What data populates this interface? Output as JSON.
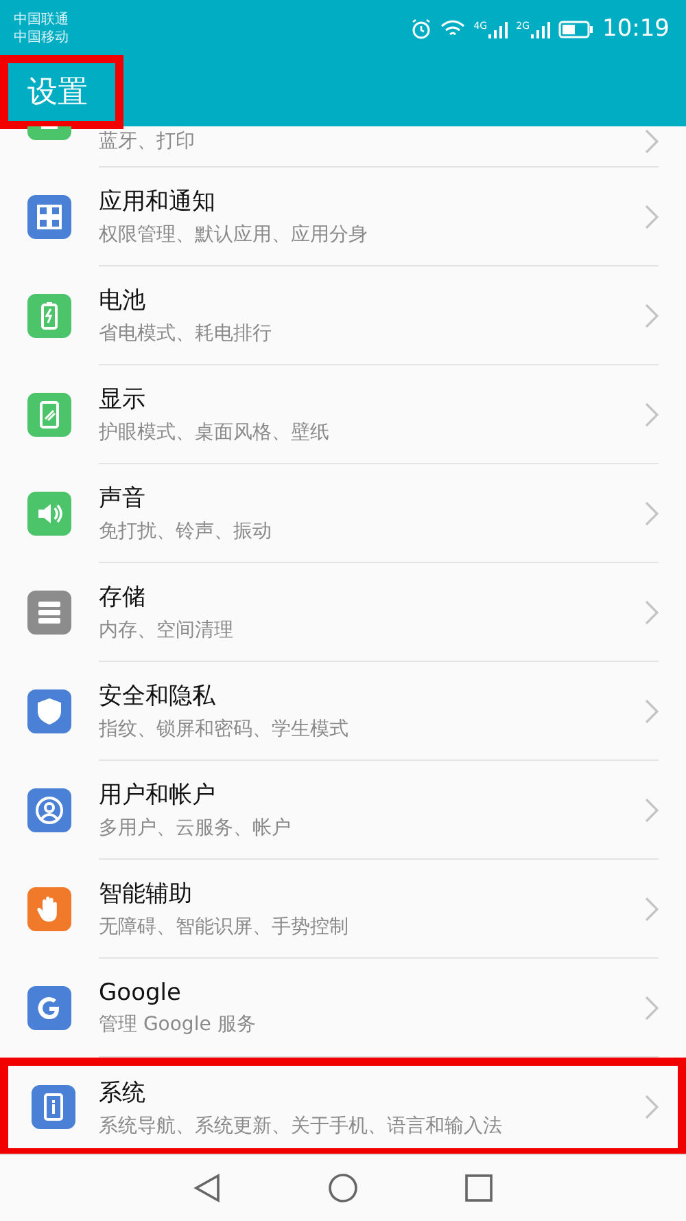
{
  "status_bar": {
    "carriers": [
      "中国联通",
      "中国移动"
    ],
    "time": "10:19",
    "network_labels": [
      "4G",
      "2G"
    ]
  },
  "header": {
    "title": "设置",
    "highlighted": true
  },
  "rows": [
    {
      "subtitle": "蓝牙、打印",
      "color": "#4cc46a",
      "highlighted": false
    },
    {
      "title": "应用和通知",
      "subtitle": "权限管理、默认应用、应用分身",
      "color": "#4a80d6",
      "highlighted": false
    },
    {
      "title": "电池",
      "subtitle": "省电模式、耗电排行",
      "color": "#4cc46a",
      "highlighted": false
    },
    {
      "title": "显示",
      "subtitle": "护眼模式、桌面风格、壁纸",
      "color": "#4cc46a",
      "highlighted": false
    },
    {
      "title": "声音",
      "subtitle": "免打扰、铃声、振动",
      "color": "#4cc46a",
      "highlighted": false
    },
    {
      "title": "存储",
      "subtitle": "内存、空间清理",
      "color": "#8c8c8c",
      "highlighted": false
    },
    {
      "title": "安全和隐私",
      "subtitle": "指纹、锁屏和密码、学生模式",
      "color": "#4a80d6",
      "highlighted": false
    },
    {
      "title": "用户和帐户",
      "subtitle": "多用户、云服务、帐户",
      "color": "#4a80d6",
      "highlighted": false
    },
    {
      "title": "智能辅助",
      "subtitle": "无障碍、智能识屏、手势控制",
      "color": "#f07a2a",
      "highlighted": false
    },
    {
      "title": "Google",
      "subtitle": "管理 Google 服务",
      "color": "#4a80d6",
      "highlighted": false
    },
    {
      "title": "系统",
      "subtitle": "系统导航、系统更新、关于手机、语言和输入法",
      "color": "#4a80d6",
      "highlighted": true
    }
  ]
}
